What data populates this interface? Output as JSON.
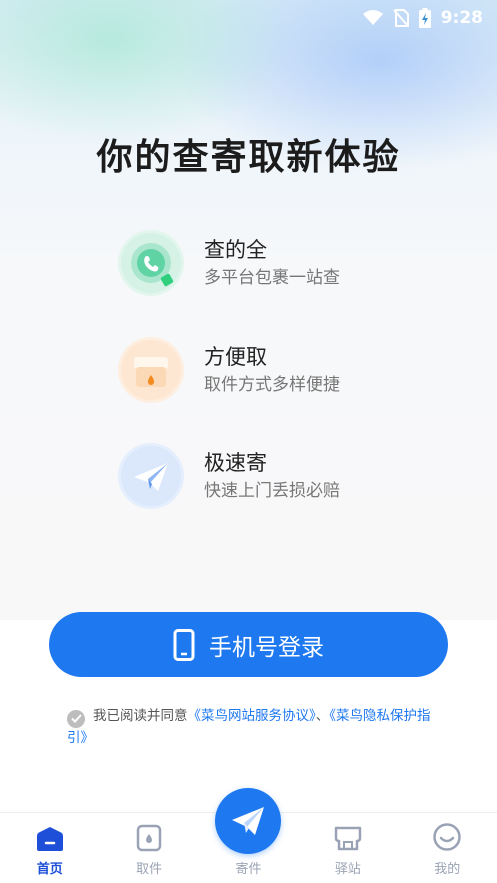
{
  "status_bar": {
    "time": "9:28"
  },
  "title": "你的查寄取新体验",
  "features": [
    {
      "name": "查的全",
      "desc": "多平台包裹一站查",
      "icon": "search-parcel-icon"
    },
    {
      "name": "方便取",
      "desc": "取件方式多样便捷",
      "icon": "pickup-box-icon"
    },
    {
      "name": "极速寄",
      "desc": "快速上门丢损必赔",
      "icon": "paper-plane-icon"
    }
  ],
  "login_button": {
    "label": "手机号登录",
    "icon": "phone-icon"
  },
  "agreement": {
    "prefix": "我已阅读并同意",
    "link1": "《菜鸟网站服务协议》",
    "separator": "、",
    "link2": "《菜鸟隐私保护指引》"
  },
  "tabs": [
    {
      "label": "首页",
      "icon": "home-icon",
      "active": true
    },
    {
      "label": "取件",
      "icon": "pickup-icon",
      "active": false
    },
    {
      "label": "寄件",
      "icon": "send-icon",
      "active": false
    },
    {
      "label": "驿站",
      "icon": "station-icon",
      "active": false
    },
    {
      "label": "我的",
      "icon": "profile-icon",
      "active": false
    }
  ],
  "colors": {
    "accent": "#1e78f0",
    "active_tab": "#1e4fd8"
  }
}
